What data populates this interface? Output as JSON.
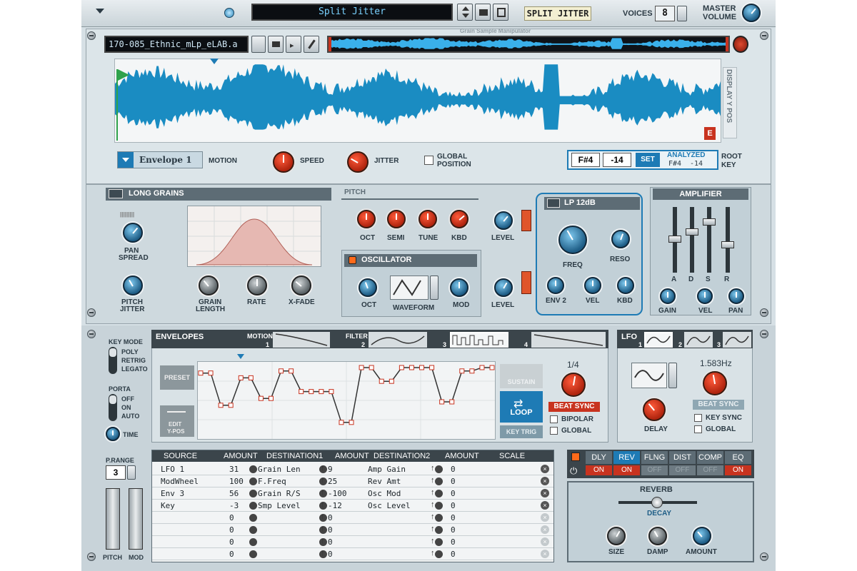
{
  "header": {
    "patch_name": "Split Jitter",
    "device_label": "SPLIT JITTER",
    "voices_label": "VOICES",
    "voices_value": "8",
    "master_label": "MASTER",
    "volume_label": "VOLUME",
    "faint_label": "Grain Sample Manipulator"
  },
  "sample": {
    "filename": "170-085_Ethnic_mLp_eLAB.a",
    "display_y_pos": "DISPLAY Y POS",
    "end_marker": "E",
    "envelope_sel": "Envelope 1",
    "motion": "MOTION",
    "speed": "SPEED",
    "jitter": "JITTER",
    "global": "GLOBAL",
    "position": "POSITION",
    "note": "F#4",
    "tune": "-14",
    "set": "SET",
    "analyzed": "ANALYZED",
    "an_note": "F#4",
    "an_tune": "-14",
    "root": "ROOT",
    "key": "KEY"
  },
  "grain": {
    "type": "LONG GRAINS",
    "pan": "PAN",
    "spread": "SPREAD",
    "pitch": "PITCH",
    "jitter": "JITTER",
    "grain": "GRAIN",
    "length": "LENGTH",
    "rate": "RATE",
    "xfade": "X-FADE"
  },
  "pitch": {
    "title": "PITCH",
    "oct": "OCT",
    "semi": "SEMI",
    "tune": "TUNE",
    "kbd": "KBD",
    "level": "LEVEL"
  },
  "osc": {
    "title": "OSCILLATOR",
    "oct": "OCT",
    "waveform": "WAVEFORM",
    "mod": "MOD",
    "level": "LEVEL"
  },
  "filter": {
    "type": "LP 12dB",
    "freq": "FREQ",
    "reso": "RESO",
    "env2": "ENV 2",
    "vel": "VEL",
    "kbd": "KBD"
  },
  "amp": {
    "title": "AMPLIFIER",
    "a": "A",
    "d": "D",
    "s": "S",
    "r": "R",
    "gain": "GAIN",
    "vel": "VEL",
    "pan": "PAN"
  },
  "left": {
    "key_mode": "KEY MODE",
    "poly": "POLY",
    "retrig": "RETRIG",
    "legato": "LEGATO",
    "porta": "PORTA",
    "off": "OFF",
    "on": "ON",
    "auto": "AUTO",
    "time": "TIME",
    "prange": "P.RANGE",
    "prange_value": "3",
    "pitch": "PITCH",
    "mod": "MOD"
  },
  "env": {
    "title": "ENVELOPES",
    "motion": "MOTION",
    "filter": "FILTER",
    "n1": "1",
    "n2": "2",
    "n3": "3",
    "n4": "4",
    "preset": "PRESET",
    "edit": "EDIT",
    "ypos": "Y-POS",
    "sustain": "SUSTAIN",
    "loop": "LOOP",
    "keytrig": "KEY TRIG",
    "rate_value": "1/4",
    "beat_sync": "BEAT SYNC",
    "bipolar": "BIPOLAR",
    "global": "GLOBAL",
    "steps": [
      0.08,
      0.08,
      0.55,
      0.55,
      0.15,
      0.15,
      0.45,
      0.45,
      0.05,
      0.05,
      0.35,
      0.35,
      0.35,
      0.35,
      0.8,
      0.8,
      0.0,
      0.0,
      0.2,
      0.2,
      0.0,
      0.0,
      0.0,
      0.0,
      0.5,
      0.5,
      0.05,
      0.05,
      0.0,
      0.0
    ]
  },
  "lfo": {
    "title": "LFO",
    "n1": "1",
    "n2": "2",
    "n3": "3",
    "rate_value": "1.583Hz",
    "delay": "DELAY",
    "beat_sync": "BEAT SYNC",
    "key_sync": "KEY SYNC",
    "global": "GLOBAL"
  },
  "mod": {
    "headers": [
      "SOURCE",
      "AMOUNT",
      "DESTINATION1",
      "AMOUNT",
      "DESTINATION2",
      "AMOUNT",
      "SCALE"
    ],
    "rows": [
      [
        "LFO 1",
        "31",
        "Grain Len",
        "9",
        "Amp Gain",
        "0"
      ],
      [
        "ModWheel",
        "100",
        "F.Freq",
        "25",
        "Rev Amt",
        "0"
      ],
      [
        "Env 3",
        "56",
        "Grain R/S",
        "-100",
        "Osc Mod",
        "0"
      ],
      [
        "Key",
        "-3",
        "Smp Level",
        "-12",
        "Osc Level",
        "0"
      ],
      [
        "",
        "0",
        "",
        "0",
        "",
        "0"
      ],
      [
        "",
        "0",
        "",
        "0",
        "",
        "0"
      ],
      [
        "",
        "0",
        "",
        "0",
        "",
        "0"
      ],
      [
        "",
        "0",
        "",
        "0",
        "",
        "0"
      ]
    ]
  },
  "fx": {
    "tabs": [
      "DLY",
      "REV",
      "FLNG",
      "DIST",
      "COMP",
      "EQ"
    ],
    "states": [
      "ON",
      "ON",
      "OFF",
      "OFF",
      "OFF",
      "ON"
    ],
    "title": "REVERB",
    "decay": "DECAY",
    "size": "SIZE",
    "damp": "DAMP",
    "amount": "AMOUNT"
  },
  "colors": {
    "wave": "#1a8cc2",
    "panel": "#d6e0e5",
    "accent_red": "#c8331f"
  }
}
